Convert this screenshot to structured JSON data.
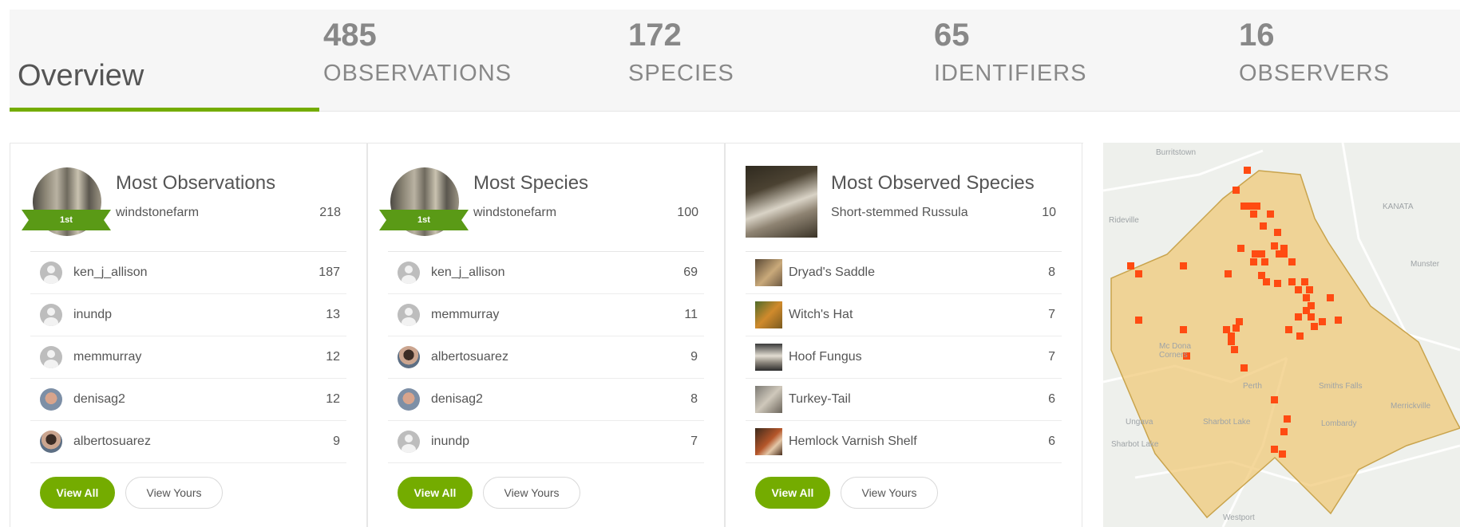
{
  "stats": {
    "overview_label": "Overview",
    "items": [
      {
        "num": "485",
        "label": "OBSERVATIONS"
      },
      {
        "num": "172",
        "label": "SPECIES"
      },
      {
        "num": "65",
        "label": "IDENTIFIERS"
      },
      {
        "num": "16",
        "label": "OBSERVERS"
      }
    ]
  },
  "panels": [
    {
      "title": "Most Observations",
      "badge": "1st",
      "top_name": "windstonefarm",
      "top_count": "218",
      "rows": [
        {
          "name": "ken_j_allison",
          "count": "187",
          "avatar": "default"
        },
        {
          "name": "inundp",
          "count": "13",
          "avatar": "default"
        },
        {
          "name": "memmurray",
          "count": "12",
          "avatar": "default"
        },
        {
          "name": "denisag2",
          "count": "12",
          "avatar": "photo-a"
        },
        {
          "name": "albertosuarez",
          "count": "9",
          "avatar": "photo-b"
        }
      ],
      "view_all": "View All",
      "view_yours": "View Yours"
    },
    {
      "title": "Most Species",
      "badge": "1st",
      "top_name": "windstonefarm",
      "top_count": "100",
      "rows": [
        {
          "name": "ken_j_allison",
          "count": "69",
          "avatar": "default"
        },
        {
          "name": "memmurray",
          "count": "11",
          "avatar": "default"
        },
        {
          "name": "albertosuarez",
          "count": "9",
          "avatar": "photo-b"
        },
        {
          "name": "denisag2",
          "count": "8",
          "avatar": "photo-a"
        },
        {
          "name": "inundp",
          "count": "7",
          "avatar": "default"
        }
      ],
      "view_all": "View All",
      "view_yours": "View Yours"
    },
    {
      "title": "Most Observed Species",
      "top_name": "Short-stemmed Russula",
      "top_count": "10",
      "rows": [
        {
          "name": "Dryad's Saddle",
          "count": "8"
        },
        {
          "name": "Witch's Hat",
          "count": "7"
        },
        {
          "name": "Hoof Fungus",
          "count": "7"
        },
        {
          "name": "Turkey-Tail",
          "count": "6"
        },
        {
          "name": "Hemlock Varnish Shelf",
          "count": "6"
        }
      ],
      "view_all": "View All",
      "view_yours": "View Yours"
    }
  ],
  "map": {
    "region_fill": "#f0c874",
    "marker_color": "#ff4b12"
  },
  "colors": {
    "accent": "#74ac00",
    "text": "#555555",
    "stat_text": "#888888"
  }
}
